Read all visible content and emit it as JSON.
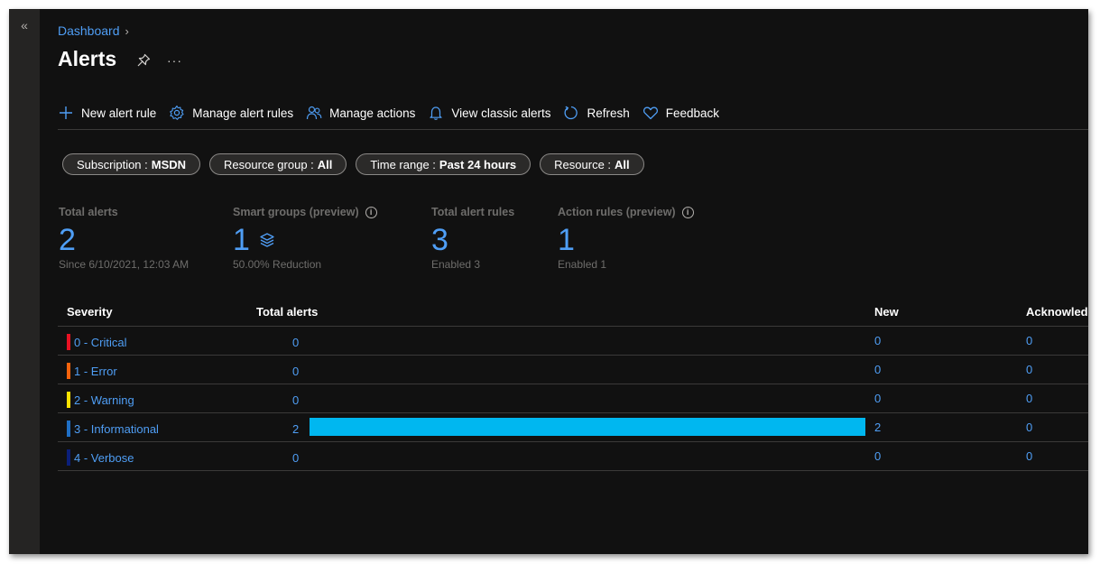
{
  "nav": {
    "collapse_glyph": "«"
  },
  "breadcrumb": {
    "label": "Dashboard",
    "separator": "›"
  },
  "title": "Alerts",
  "header_icons": [
    "pin-icon",
    "more-icon"
  ],
  "toolbar": {
    "new_alert_rule": "New alert rule",
    "manage_alert_rules": "Manage alert rules",
    "manage_actions": "Manage actions",
    "view_classic_alerts": "View classic alerts",
    "refresh": "Refresh",
    "feedback": "Feedback"
  },
  "filters": [
    {
      "label": "Subscription :",
      "value": "MSDN"
    },
    {
      "label": "Resource group :",
      "value": "All"
    },
    {
      "label": "Time range :",
      "value": "Past 24 hours"
    },
    {
      "label": "Resource :",
      "value": "All"
    }
  ],
  "kpis": {
    "total_alerts": {
      "label": "Total alerts",
      "value": "2",
      "sub": "Since 6/10/2021, 12:03 AM"
    },
    "smart_groups": {
      "label": "Smart groups (preview)",
      "value": "1",
      "sub": "50.00% Reduction"
    },
    "total_alert_rules": {
      "label": "Total alert rules",
      "value": "3",
      "sub": "Enabled 3"
    },
    "action_rules": {
      "label": "Action rules (preview)",
      "value": "1",
      "sub": "Enabled 1"
    }
  },
  "table": {
    "headers": {
      "severity": "Severity",
      "total": "Total alerts",
      "new": "New",
      "acknowledged": "Acknowledg"
    },
    "rows": [
      {
        "name": "0 - Critical",
        "total": "0",
        "new": "0",
        "ack": "0",
        "color": "#e81123",
        "fraction": 0
      },
      {
        "name": "1 - Error",
        "total": "0",
        "new": "0",
        "ack": "0",
        "color": "#f7630c",
        "fraction": 0
      },
      {
        "name": "2 - Warning",
        "total": "0",
        "new": "0",
        "ack": "0",
        "color": "#fce100",
        "fraction": 0
      },
      {
        "name": "3 - Informational",
        "total": "2",
        "new": "2",
        "ack": "0",
        "color": "#1f6fc5",
        "fraction": 1
      },
      {
        "name": "4 - Verbose",
        "total": "0",
        "new": "0",
        "ack": "0",
        "color": "#0b1f7a",
        "fraction": 0
      }
    ]
  },
  "colors": {
    "background": "#111111",
    "accent": "#4f9ef5",
    "bar": "#00b7f0"
  }
}
